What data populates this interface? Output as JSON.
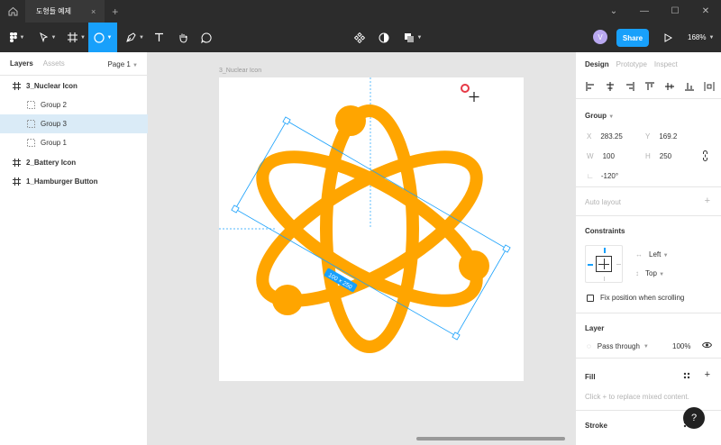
{
  "titlebar": {
    "tab_title": "도형들 예제",
    "tab_close": "×",
    "new_tab": "+",
    "window_controls": [
      "⌄",
      "—",
      "☐",
      "✕"
    ]
  },
  "toolbar": {
    "avatar_initial": "V",
    "share_label": "Share",
    "zoom": "168%"
  },
  "left_panel": {
    "tabs": [
      "Layers",
      "Assets"
    ],
    "page": "Page 1",
    "layers": [
      {
        "name": "3_Nuclear Icon",
        "kind": "frame",
        "selected": false
      },
      {
        "name": "Group 2",
        "kind": "group",
        "selected": false
      },
      {
        "name": "Group 3",
        "kind": "group",
        "selected": true
      },
      {
        "name": "Group 1",
        "kind": "group",
        "selected": false
      },
      {
        "name": "2_Battery Icon",
        "kind": "frame",
        "selected": false
      },
      {
        "name": "1_Hamburger Button",
        "kind": "frame",
        "selected": false
      }
    ]
  },
  "canvas": {
    "frame_label": "3_Nuclear Icon",
    "size_badge": "100 × 250",
    "icon_color": "#FFA500",
    "selection_color": "#18A0FB"
  },
  "right_panel": {
    "tabs": [
      "Design",
      "Prototype",
      "Inspect"
    ],
    "group_title": "Group",
    "x_label": "X",
    "x_value": "283.25",
    "y_label": "Y",
    "y_value": "169.2",
    "w_label": "W",
    "w_value": "100",
    "h_label": "H",
    "h_value": "250",
    "rotation": "-120°",
    "auto_layout": "Auto layout",
    "constraints_title": "Constraints",
    "constraint_h": "Left",
    "constraint_v": "Top",
    "fix_position": "Fix position when scrolling",
    "layer_title": "Layer",
    "blend_mode": "Pass through",
    "opacity": "100%",
    "fill_title": "Fill",
    "fill_hint": "Click + to replace mixed content.",
    "stroke_title": "Stroke",
    "help": "?"
  }
}
